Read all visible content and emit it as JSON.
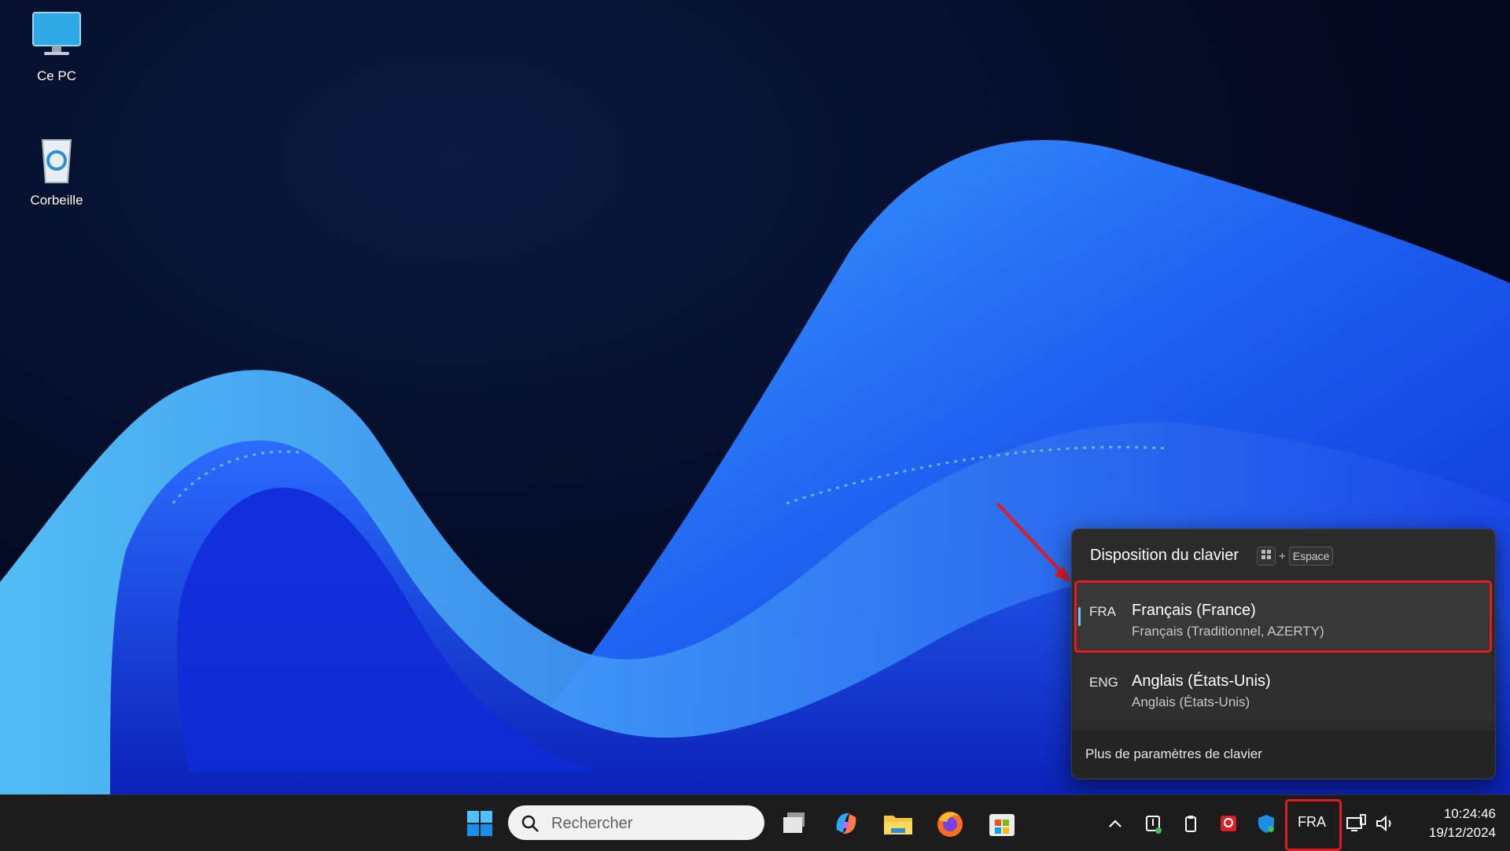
{
  "desktop": {
    "icons": [
      {
        "label": "Ce PC",
        "icon": "computer-icon"
      },
      {
        "label": "Corbeille",
        "icon": "recycle-bin-icon"
      }
    ]
  },
  "keyboard_flyout": {
    "title": "Disposition du clavier",
    "shortcut": {
      "plus": "+",
      "key": "Espace"
    },
    "languages": [
      {
        "code": "FRA",
        "name": "Français (France)",
        "layout": "Français (Traditionnel, AZERTY)",
        "selected": true
      },
      {
        "code": "ENG",
        "name": "Anglais (États-Unis)",
        "layout": "Anglais (États-Unis)",
        "selected": false
      }
    ],
    "more_settings": "Plus de paramètres de clavier"
  },
  "taskbar": {
    "search_placeholder": "Rechercher",
    "apps": [
      "start-icon",
      "task-view-icon",
      "copilot-icon",
      "file-explorer-icon",
      "firefox-icon",
      "microsoft-store-icon"
    ],
    "tray": {
      "input_indicator": "FRA",
      "time": "10:24:46",
      "date": "19/12/2024"
    }
  },
  "colors": {
    "highlight": "#e01b24",
    "accent": "#60cdff"
  }
}
